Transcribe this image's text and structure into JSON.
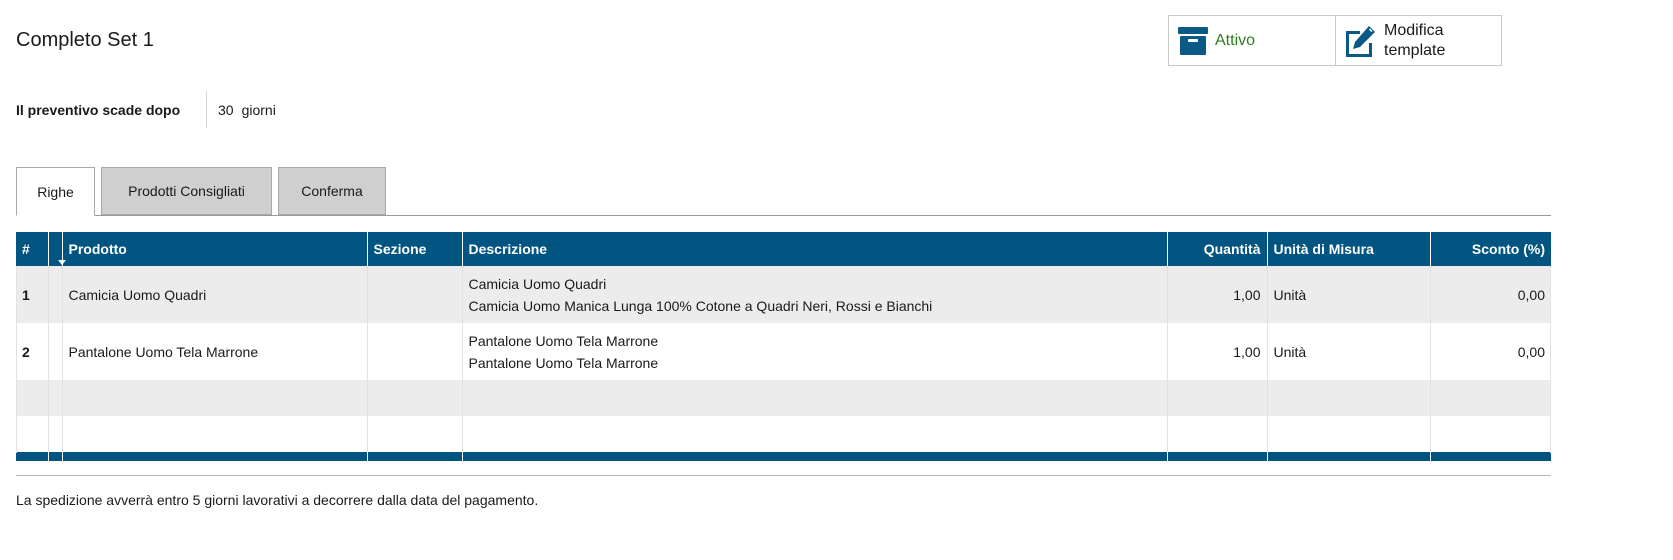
{
  "header": {
    "title": "Completo Set 1",
    "status": {
      "label": "Attivo",
      "icon": "archive-box-icon",
      "color": "#2e7d1e"
    },
    "edit": {
      "label": "Modifica template",
      "icon": "edit-icon"
    }
  },
  "expiry": {
    "label": "Il preventivo scade dopo",
    "value": "30",
    "unit": "giorni"
  },
  "tabs": [
    {
      "label": "Righe",
      "selected": true
    },
    {
      "label": "Prodotti Consigliati",
      "selected": false
    },
    {
      "label": "Conferma",
      "selected": false
    }
  ],
  "table": {
    "header_color": "#015580",
    "columns": {
      "num": "#",
      "product": "Prodotto",
      "section": "Sezione",
      "description": "Descrizione",
      "quantity": "Quantità",
      "unit": "Unità di Misura",
      "discount": "Sconto (%)"
    },
    "rows": [
      {
        "num": "1",
        "product": "Camicia Uomo Quadri",
        "section": "",
        "description_line1": "Camicia Uomo Quadri",
        "description_line2": "Camicia Uomo Manica Lunga 100% Cotone a Quadri Neri, Rossi e Bianchi",
        "quantity": "1,00",
        "unit": "Unità",
        "discount": "0,00"
      },
      {
        "num": "2",
        "product": "Pantalone Uomo Tela Marrone",
        "section": "",
        "description_line1": "Pantalone Uomo Tela Marrone",
        "description_line2": "Pantalone Uomo Tela Marrone",
        "quantity": "1,00",
        "unit": "Unità",
        "discount": "0,00"
      }
    ]
  },
  "footer_note": "La spedizione avverrà entro 5 giorni lavorativi a decorrere dalla data del pagamento."
}
